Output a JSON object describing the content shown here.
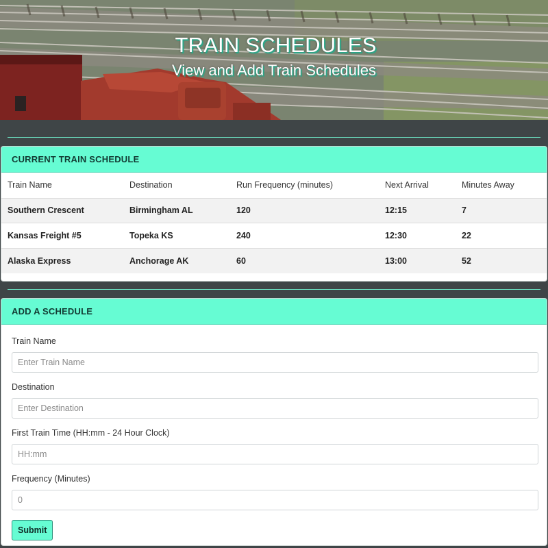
{
  "hero": {
    "title": "TRAIN SCHEDULES",
    "subtitle": "View and Add Train Schedules"
  },
  "schedule_panel": {
    "heading": "CURRENT TRAIN SCHEDULE",
    "columns": [
      "Train Name",
      "Destination",
      "Run Frequency (minutes)",
      "Next Arrival",
      "Minutes Away"
    ],
    "rows": [
      [
        "Southern Crescent",
        "Birmingham AL",
        "120",
        "12:15",
        "7"
      ],
      [
        "Kansas Freight #5",
        "Topeka KS",
        "240",
        "12:30",
        "22"
      ],
      [
        "Alaska Express",
        "Anchorage AK",
        "60",
        "13:00",
        "52"
      ]
    ]
  },
  "add_panel": {
    "heading": "ADD A SCHEDULE",
    "fields": [
      {
        "label": "Train Name",
        "placeholder": "Enter Train Name",
        "value": ""
      },
      {
        "label": "Destination",
        "placeholder": "Enter Destination",
        "value": ""
      },
      {
        "label": "First Train Time (HH:mm - 24 Hour Clock)",
        "placeholder": "HH:mm",
        "value": ""
      },
      {
        "label": "Frequency (Minutes)",
        "placeholder": "0",
        "value": ""
      }
    ],
    "submit_label": "Submit"
  },
  "colors": {
    "accent": "#66fcd3",
    "page_background": "#3f4547",
    "divider": "#6ee8c7"
  }
}
